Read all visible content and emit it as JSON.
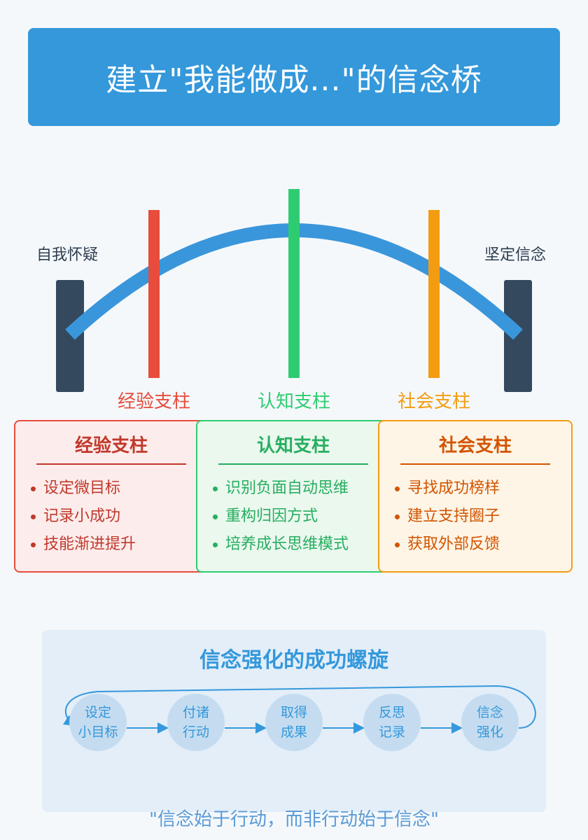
{
  "title": "建立\"我能做成...\"的信念桥",
  "bridge": {
    "left_label": "自我怀疑",
    "right_label": "坚定信念",
    "pillars": [
      {
        "label": "经验支柱",
        "color": "#e74c3c"
      },
      {
        "label": "认知支柱",
        "color": "#2ecc71"
      },
      {
        "label": "社会支柱",
        "color": "#f39c12"
      }
    ],
    "arch_color": "#3a96db",
    "abutment_color": "#34495e"
  },
  "cards": [
    {
      "title": "经验支柱",
      "items": [
        "设定微目标",
        "记录小成功",
        "技能渐进提升"
      ],
      "border": "#e74c3c",
      "bg": "#fdecec",
      "text": "#c0392b"
    },
    {
      "title": "认知支柱",
      "items": [
        "识别负面自动思维",
        "重构归因方式",
        "培养成长思维模式"
      ],
      "border": "#2ecc71",
      "bg": "#eaf8ee",
      "text": "#27ae60"
    },
    {
      "title": "社会支柱",
      "items": [
        "寻找成功榜样",
        "建立支持圈子",
        "获取外部反馈"
      ],
      "border": "#f39c12",
      "bg": "#fef5e6",
      "text": "#d35400"
    }
  ],
  "spiral": {
    "title": "信念强化的成功螺旋",
    "steps": [
      {
        "line1": "设定",
        "line2": "小目标"
      },
      {
        "line1": "付诸",
        "line2": "行动"
      },
      {
        "line1": "取得",
        "line2": "成果"
      },
      {
        "line1": "反思",
        "line2": "记录"
      },
      {
        "line1": "信念",
        "line2": "强化"
      }
    ]
  },
  "quote": "\"信念始于行动，而非行动始于信念\""
}
